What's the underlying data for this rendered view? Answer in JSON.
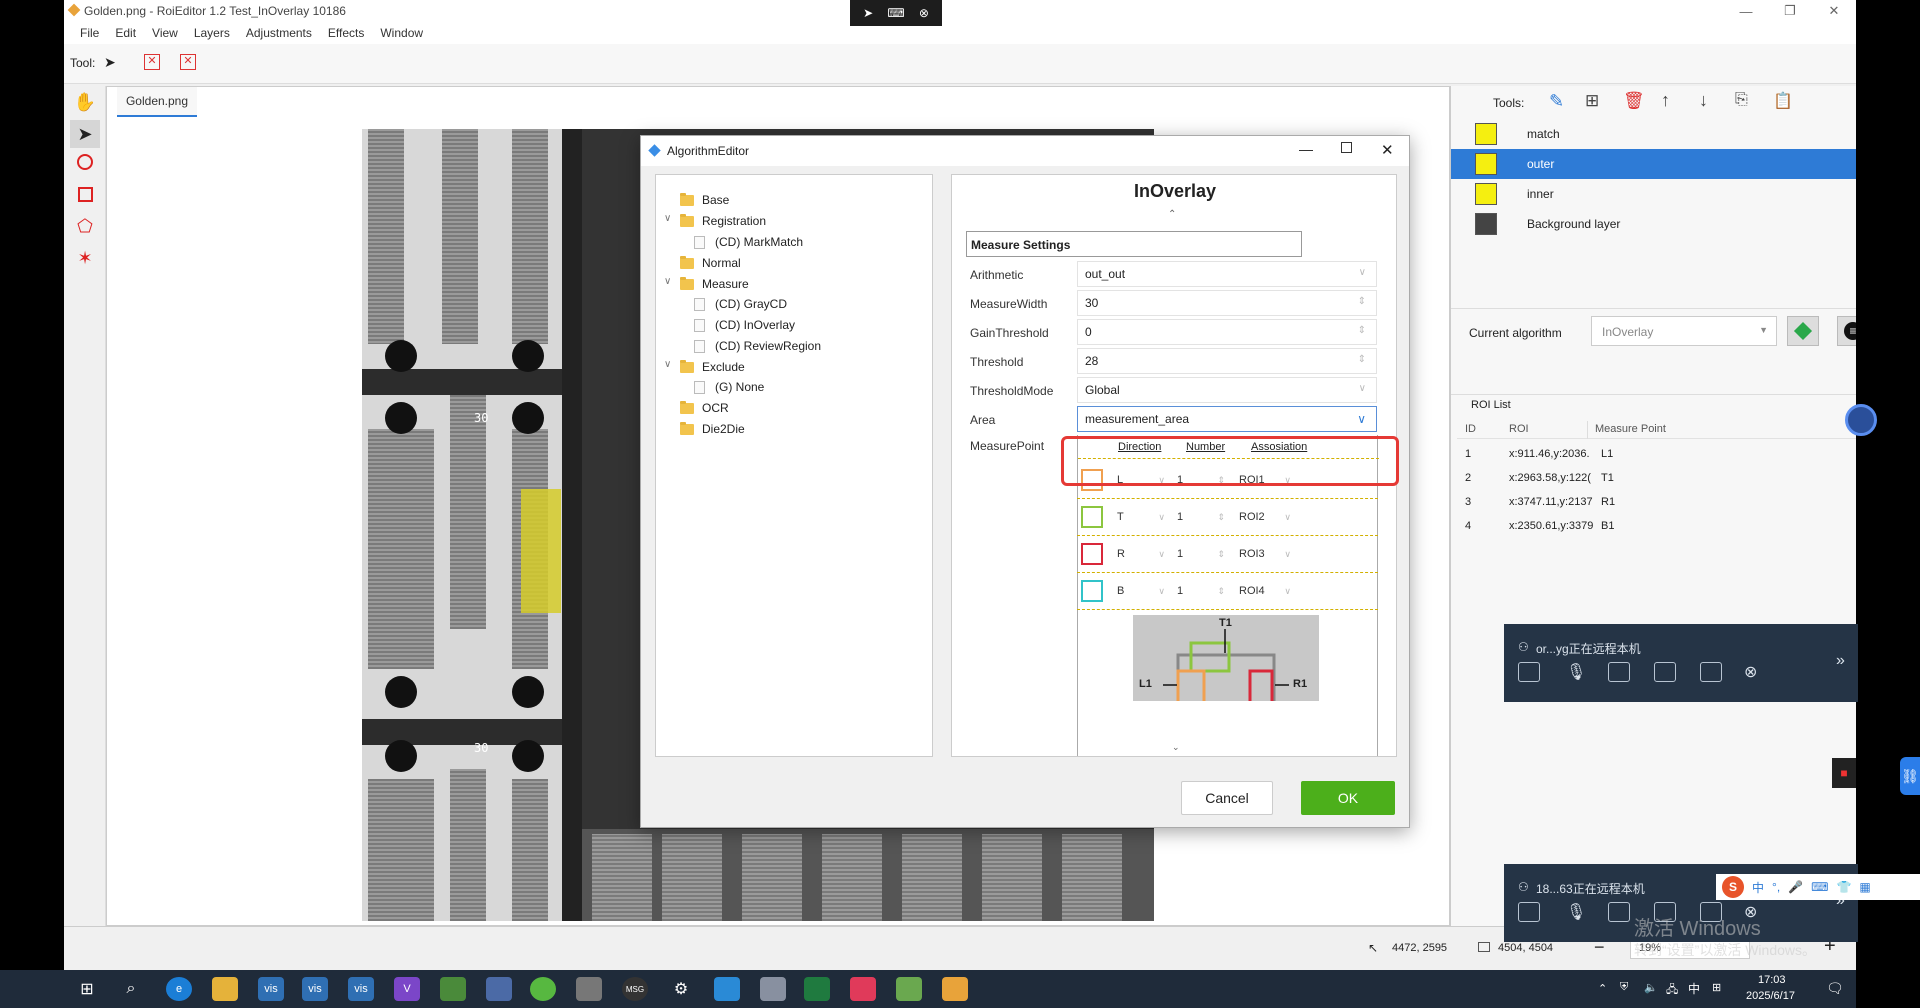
{
  "window": {
    "title": "Golden.png - RoiEditor 1.2 Test_InOverlay 10186"
  },
  "menu": [
    "File",
    "Edit",
    "View",
    "Layers",
    "Adjustments",
    "Effects",
    "Window"
  ],
  "toolbar": {
    "tool_label": "Tool:"
  },
  "document": {
    "tab": "Golden.png",
    "markers": [
      "30",
      "30"
    ]
  },
  "dialog": {
    "title": "AlgorithmEditor",
    "tree": [
      {
        "label": "Base",
        "kind": "folder",
        "level": 0
      },
      {
        "label": "Registration",
        "kind": "folder",
        "level": 0,
        "expanded": true
      },
      {
        "label": "(CD) MarkMatch",
        "kind": "item",
        "level": 1
      },
      {
        "label": "Normal",
        "kind": "folder",
        "level": 0
      },
      {
        "label": "Measure",
        "kind": "folder",
        "level": 0,
        "expanded": true
      },
      {
        "label": "(CD) GrayCD",
        "kind": "item",
        "level": 1
      },
      {
        "label": "(CD) InOverlay",
        "kind": "item",
        "level": 1
      },
      {
        "label": "(CD) ReviewRegion",
        "kind": "item",
        "level": 1
      },
      {
        "label": "Exclude",
        "kind": "folder",
        "level": 0,
        "expanded": true
      },
      {
        "label": "(G) None",
        "kind": "item",
        "level": 1
      },
      {
        "label": "OCR",
        "kind": "folder",
        "level": 0
      },
      {
        "label": "Die2Die",
        "kind": "folder",
        "level": 0
      }
    ],
    "algorithm_title": "InOverlay",
    "section": "Measure Settings",
    "fields": [
      {
        "label": "Arithmetic",
        "value": "out_out"
      },
      {
        "label": "MeasureWidth",
        "value": "30"
      },
      {
        "label": "GainThreshold",
        "value": "0"
      },
      {
        "label": "Threshold",
        "value": "28"
      },
      {
        "label": "ThresholdMode",
        "value": "Global"
      },
      {
        "label": "Area",
        "value": "measurement_area"
      }
    ],
    "measure_point": {
      "label": "MeasurePoint",
      "headers": [
        "Direction",
        "Number",
        "Assosiation"
      ],
      "rows": [
        {
          "direction": "L",
          "number": "1",
          "association": "ROI1",
          "color": "#f0a050"
        },
        {
          "direction": "T",
          "number": "1",
          "association": "ROI2",
          "color": "#8cc63f"
        },
        {
          "direction": "R",
          "number": "1",
          "association": "ROI3",
          "color": "#d9283a"
        },
        {
          "direction": "B",
          "number": "1",
          "association": "ROI4",
          "color": "#31c3c9"
        }
      ],
      "diagram_labels": [
        "T1",
        "L1",
        "R1"
      ]
    },
    "cancel": "Cancel",
    "ok": "OK"
  },
  "right_panel": {
    "tools_label": "Tools:",
    "layers": [
      {
        "name": "match",
        "selected": false
      },
      {
        "name": "outer",
        "selected": true
      },
      {
        "name": "inner",
        "selected": false
      },
      {
        "name": "Background layer",
        "selected": false
      }
    ],
    "current_algorithm_label": "Current algorithm",
    "current_algorithm": "InOverlay",
    "roi_list_title": "ROI List",
    "roi_headers": [
      "ID",
      "ROI",
      "Measure Point"
    ],
    "roi_rows": [
      {
        "id": "1",
        "roi": "x:911.46,y:2036.",
        "mp": "L1"
      },
      {
        "id": "2",
        "roi": "x:2963.58,y:122(",
        "mp": "T1"
      },
      {
        "id": "3",
        "roi": "x:3747.11,y:2137",
        "mp": "R1"
      },
      {
        "id": "4",
        "roi": "x:2350.61,y:3379",
        "mp": "B1"
      }
    ]
  },
  "status": {
    "cursor": "4472, 2595",
    "size": "4504, 4504",
    "zoom": "19%"
  },
  "popups": [
    {
      "text": "or...yg正在远程本机"
    },
    {
      "text": "18...63正在远程本机"
    }
  ],
  "ime": {
    "lang": "中"
  },
  "watermark": {
    "line1": "激活 Windows",
    "line2": "转到“设置”以激活 Windows。"
  },
  "tray": {
    "lang": "中",
    "time": "17:03",
    "date": "2025/6/17"
  },
  "colors": {
    "accent": "#2e7bd6",
    "ok_green": "#4caf1b",
    "highlight_red": "#e53935",
    "layer_yellow": "#f5ef10"
  }
}
